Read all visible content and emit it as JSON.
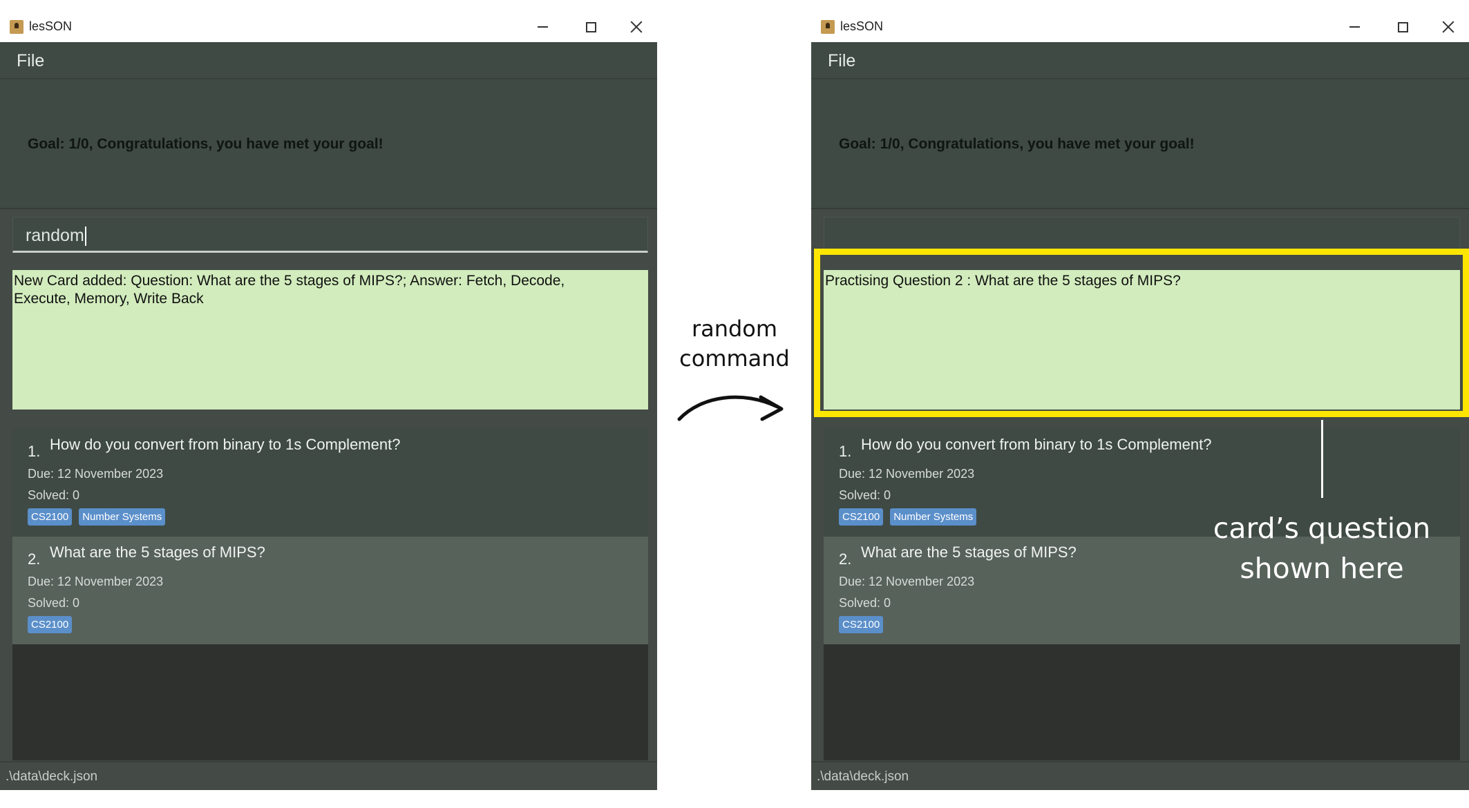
{
  "app": {
    "title": "lesSON",
    "menu_file": "File",
    "goal_text": "Goal: 1/0, Congratulations, you have met your goal!",
    "status_path": ".\\data\\deck.json"
  },
  "left_window": {
    "command_input": "random",
    "result_text": "New Card added: Question: What are the 5 stages of MIPS?; Answer: Fetch, Decode,\nExecute, Memory, Write Back"
  },
  "right_window": {
    "command_input": "",
    "result_text": "Practising Question 2 : What are the 5 stages of MIPS?"
  },
  "cards": [
    {
      "index": "1.",
      "question": "How do you convert from binary to 1s Complement?",
      "due": "Due: 12 November 2023",
      "solved": "Solved: 0",
      "tags": [
        "CS2100",
        "Number Systems"
      ]
    },
    {
      "index": "2.",
      "question": "What are the 5 stages of MIPS?",
      "due": "Due: 12 November 2023",
      "solved": "Solved: 0",
      "tags": [
        "CS2100"
      ]
    }
  ],
  "annotations": {
    "arrow_label_line1": "random",
    "arrow_label_line2": "command",
    "callout_line1": "card’s question",
    "callout_line2": "shown here",
    "highlight_color": "#ffe600"
  },
  "colors": {
    "result_bg": "#d2ecbd",
    "panel_bg": "#3f4a45",
    "selected_card_bg": "#57625b",
    "tag_bg": "#5b8fca"
  }
}
